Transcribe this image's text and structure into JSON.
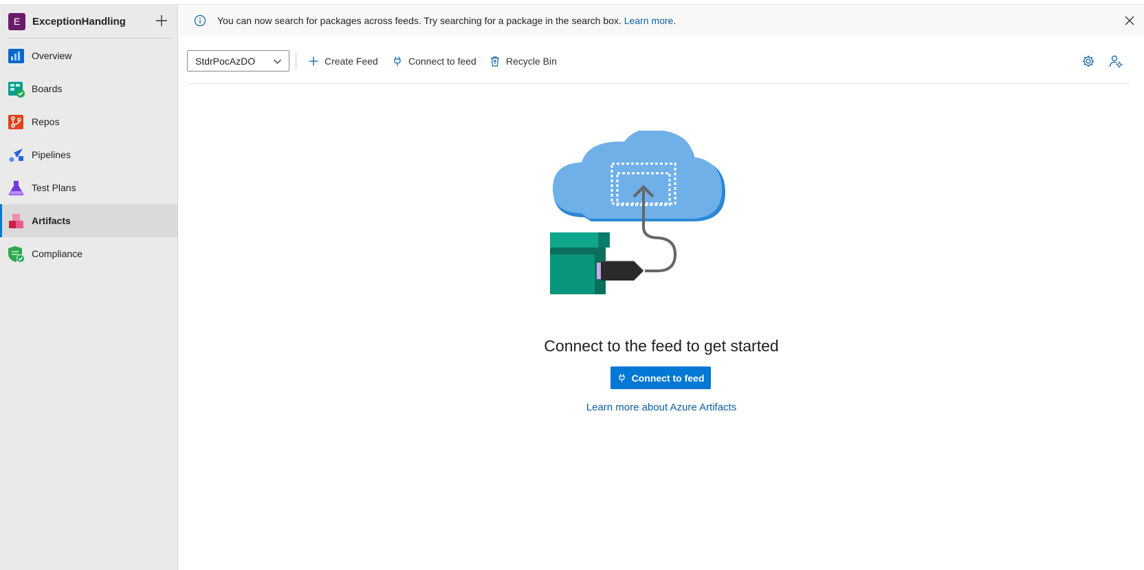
{
  "project": {
    "initial": "E",
    "name": "ExceptionHandling"
  },
  "sidebar": {
    "items": [
      {
        "label": "Overview",
        "icon": "overview-icon"
      },
      {
        "label": "Boards",
        "icon": "boards-icon"
      },
      {
        "label": "Repos",
        "icon": "repos-icon"
      },
      {
        "label": "Pipelines",
        "icon": "pipelines-icon"
      },
      {
        "label": "Test Plans",
        "icon": "test-plans-icon"
      },
      {
        "label": "Artifacts",
        "icon": "artifacts-icon",
        "active": true
      },
      {
        "label": "Compliance",
        "icon": "compliance-icon"
      }
    ]
  },
  "banner": {
    "text": "You can now search for packages across feeds. Try searching for a package in the search box.",
    "link": "Learn more",
    "suffix": "."
  },
  "toolbar": {
    "feed_selected": "StdrPocAzDO",
    "create_feed": "Create Feed",
    "connect_to_feed": "Connect to feed",
    "recycle_bin": "Recycle Bin"
  },
  "main": {
    "headline": "Connect to the feed to get started",
    "primary_button": "Connect to feed",
    "learn_more": "Learn more about Azure Artifacts"
  },
  "colors": {
    "accent": "#0078d4",
    "link": "#0b5fa5",
    "project_badge": "#6b1b6b",
    "sidebar_bg": "#eaeaea"
  }
}
